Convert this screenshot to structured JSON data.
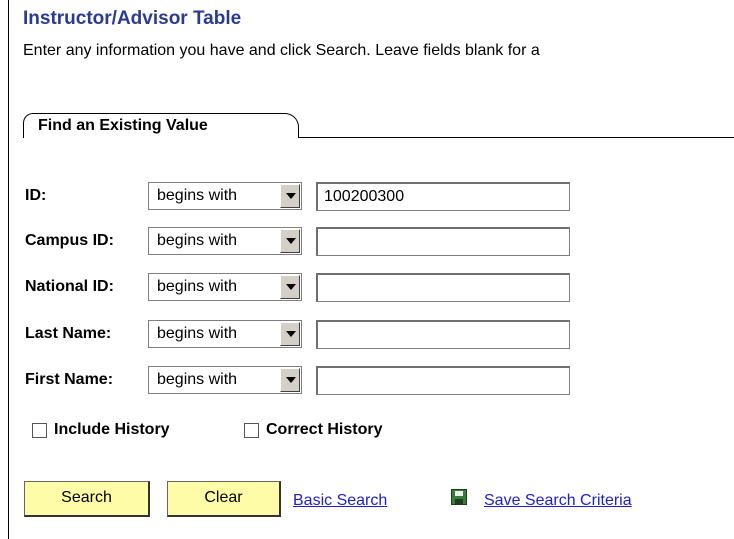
{
  "page": {
    "title": "Instructor/Advisor Table",
    "instructions": "Enter any information you have and click Search. Leave fields blank for a"
  },
  "tab": {
    "label": "Find an Existing Value"
  },
  "fields": [
    {
      "label": "ID:",
      "operator": "begins with",
      "value": "100200300"
    },
    {
      "label": "Campus ID:",
      "operator": "begins with",
      "value": ""
    },
    {
      "label": "National ID:",
      "operator": "begins with",
      "value": ""
    },
    {
      "label": "Last Name:",
      "operator": "begins with",
      "value": ""
    },
    {
      "label": "First Name:",
      "operator": "begins with",
      "value": ""
    }
  ],
  "checkboxes": {
    "include_history": {
      "label": "Include History",
      "checked": false
    },
    "correct_history": {
      "label": "Correct History",
      "checked": false
    }
  },
  "actions": {
    "search_label": "Search",
    "clear_label": "Clear",
    "basic_search_label": "Basic Search",
    "save_criteria_label": "Save Search Criteria"
  },
  "colors": {
    "title": "#2b3b8f",
    "button_bg": "#fefca6",
    "link": "#2020c8"
  },
  "icons": {
    "save_criteria": "save-disk-icon"
  }
}
